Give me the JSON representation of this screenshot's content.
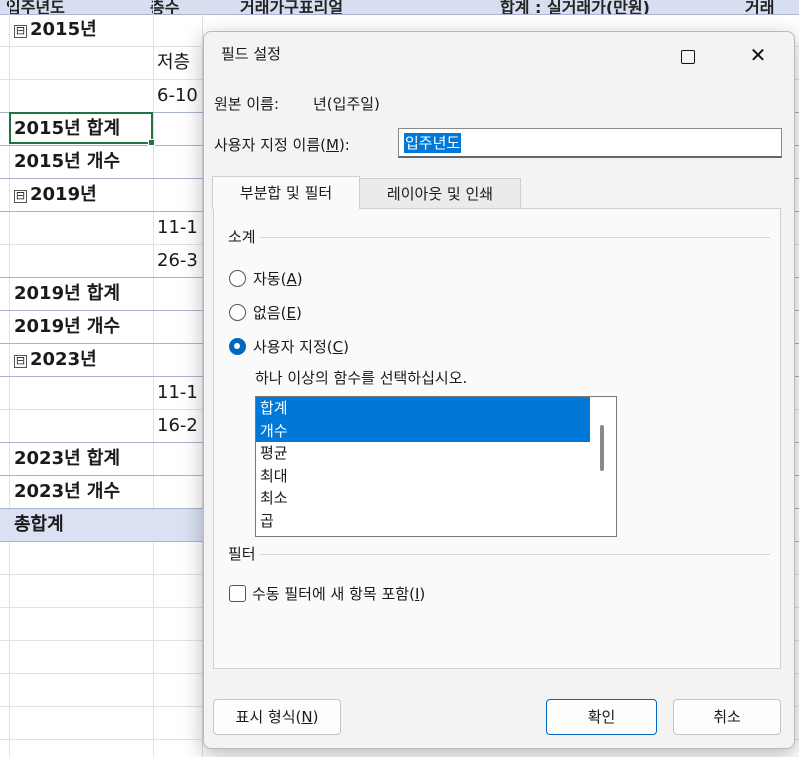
{
  "sheet": {
    "header_fragments": [
      "입주년도",
      "층수",
      "거래가구표리얼",
      "합계 : 실거래가(만원)",
      "거래"
    ],
    "rows": [
      {
        "label": "2015년",
        "kind": "group"
      },
      {
        "label": "저층",
        "kind": "item"
      },
      {
        "label": "6-10",
        "kind": "item"
      },
      {
        "label": "2015년 합계",
        "kind": "subtotal"
      },
      {
        "label": "2015년 개수",
        "kind": "subtotal"
      },
      {
        "label": "2019년",
        "kind": "group"
      },
      {
        "label": "11-1",
        "kind": "item"
      },
      {
        "label": "26-3",
        "kind": "item"
      },
      {
        "label": "2019년 합계",
        "kind": "subtotal"
      },
      {
        "label": "2019년 개수",
        "kind": "subtotal"
      },
      {
        "label": "2023년",
        "kind": "group"
      },
      {
        "label": "11-1",
        "kind": "item"
      },
      {
        "label": "16-2",
        "kind": "item"
      },
      {
        "label": "2023년 합계",
        "kind": "subtotal"
      },
      {
        "label": "2023년 개수",
        "kind": "subtotal"
      },
      {
        "label": "총합계",
        "kind": "grand"
      }
    ],
    "collapse_glyph": "⊟"
  },
  "dialog": {
    "title": "필드 설정",
    "maximize_icon": "maximize-icon",
    "close_glyph": "✕",
    "source_name_label": "원본 이름:",
    "source_name_value": "년(입주일)",
    "custom_name_label_pre": "사용자 지정 이름(",
    "custom_name_key": "M",
    "custom_name_label_post": "):",
    "custom_name_value": "입주년도",
    "tabs": [
      {
        "label": "부분합 및 필터",
        "active": true
      },
      {
        "label": "레이아웃 및 인쇄",
        "active": false
      }
    ],
    "subtotals_title": "소계",
    "radio_options": [
      {
        "pre": "자동(",
        "key": "A",
        "post": ")",
        "checked": false
      },
      {
        "pre": "없음(",
        "key": "E",
        "post": ")",
        "checked": false
      },
      {
        "pre": "사용자 지정(",
        "key": "C",
        "post": ")",
        "checked": true
      }
    ],
    "functions_prompt": "하나 이상의 함수를 선택하십시오.",
    "functions": [
      {
        "label": "합계",
        "selected": true
      },
      {
        "label": "개수",
        "selected": true
      },
      {
        "label": "평균",
        "selected": false
      },
      {
        "label": "최대",
        "selected": false
      },
      {
        "label": "최소",
        "selected": false
      },
      {
        "label": "곱",
        "selected": false
      }
    ],
    "filter_title": "필터",
    "filter_checkbox": {
      "pre": "수동 필터에 새 항목 포함(",
      "key": "I",
      "post": ")",
      "checked": false
    },
    "number_format_button": {
      "pre": "표시 형식(",
      "key": "N",
      "post": ")"
    },
    "ok_button": "확인",
    "cancel_button": "취소",
    "accent_color": "#0067c0",
    "selection_color": "#0078d7"
  }
}
